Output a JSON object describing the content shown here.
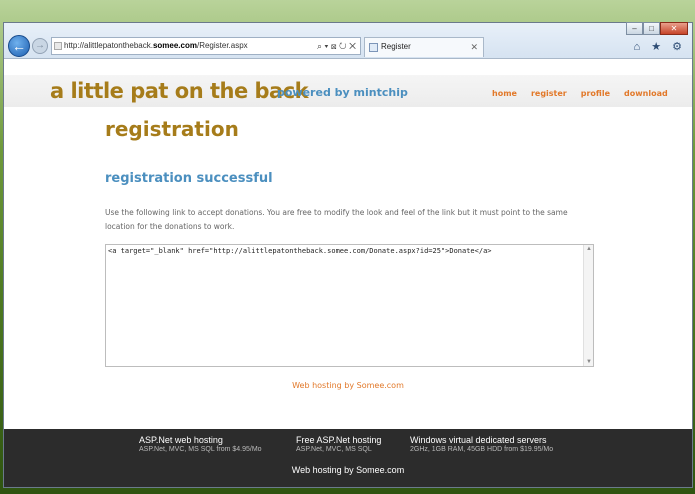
{
  "browser": {
    "address_prefix": "http://alittlepatontheback.",
    "address_domain": "somee.com",
    "address_path": "/Register.aspx",
    "address_tools": "⌕ ▾ ⊠ ↻ ✕",
    "tab_title": "Register",
    "tab_close": "✕",
    "back_icon": "←",
    "forward_icon": "→",
    "right_icons": "⌂ ★ ⚙",
    "win_min": "–",
    "win_max": "□",
    "win_close": "✕"
  },
  "site": {
    "title": "a little pat on the back",
    "powered": "powered by mintchip",
    "nav": [
      "home",
      "register",
      "profile",
      "download"
    ]
  },
  "page": {
    "title": "registration",
    "subtitle": "registration successful",
    "description": "Use the following link to accept donations. You are free to modify the look and feel of the link but it must point to the same location for the donations to work.",
    "code": "<a target=\"_blank\" href=\"http://alittlepatontheback.somee.com/Donate.aspx?id=25\">Donate</a>",
    "scroll_up": "▲",
    "scroll_down": "▼",
    "hosting_link": "Web hosting by Somee.com"
  },
  "footer": {
    "ads": [
      {
        "title": "ASP.Net web hosting",
        "sub": "ASP.Net, MVC, MS SQL from $4.95/Mo"
      },
      {
        "title": "Free ASP.Net hosting",
        "sub": "ASP.Net, MVC, MS SQL"
      },
      {
        "title": "Windows virtual dedicated servers",
        "sub": "2GHz, 1GB RAM, 45GB HDD from $19.95/Mo"
      }
    ],
    "bottom": "Web hosting by Somee.com"
  },
  "colors": {
    "title_gold": "#a67c1a",
    "accent_blue": "#4b8fbf",
    "link_orange": "#e2792a",
    "footer_bg": "#2c2c2c"
  }
}
